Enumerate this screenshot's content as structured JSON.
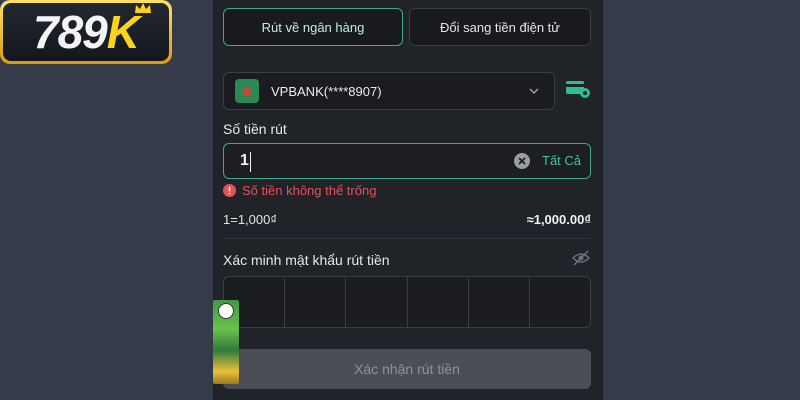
{
  "brand": {
    "logo_text": "789K"
  },
  "tabs": [
    {
      "label": "Rút về ngân hàng",
      "active": true
    },
    {
      "label": "Đổi sang tiền điện tử",
      "active": false
    }
  ],
  "bank": {
    "selected": "VPBANK(****8907)"
  },
  "amount": {
    "label": "Số tiền rút",
    "value": "1",
    "all_button": "Tất Cả",
    "error": "Số tiền không thể trống",
    "rate": "1=1,000₫",
    "converted": "≈1,000.00₫"
  },
  "password": {
    "label": "Xác minh mật khẩu rút tiền",
    "digits": 6
  },
  "confirm_button": "Xác nhận rút tiền",
  "colors": {
    "accent": "#3ea98c",
    "error": "#e2525a",
    "panel": "#202328",
    "background": "#363b49"
  },
  "icons": [
    "bank-logo-icon",
    "chevron-down-icon",
    "card-settings-icon",
    "clear-icon",
    "error-icon",
    "eye-off-icon"
  ]
}
